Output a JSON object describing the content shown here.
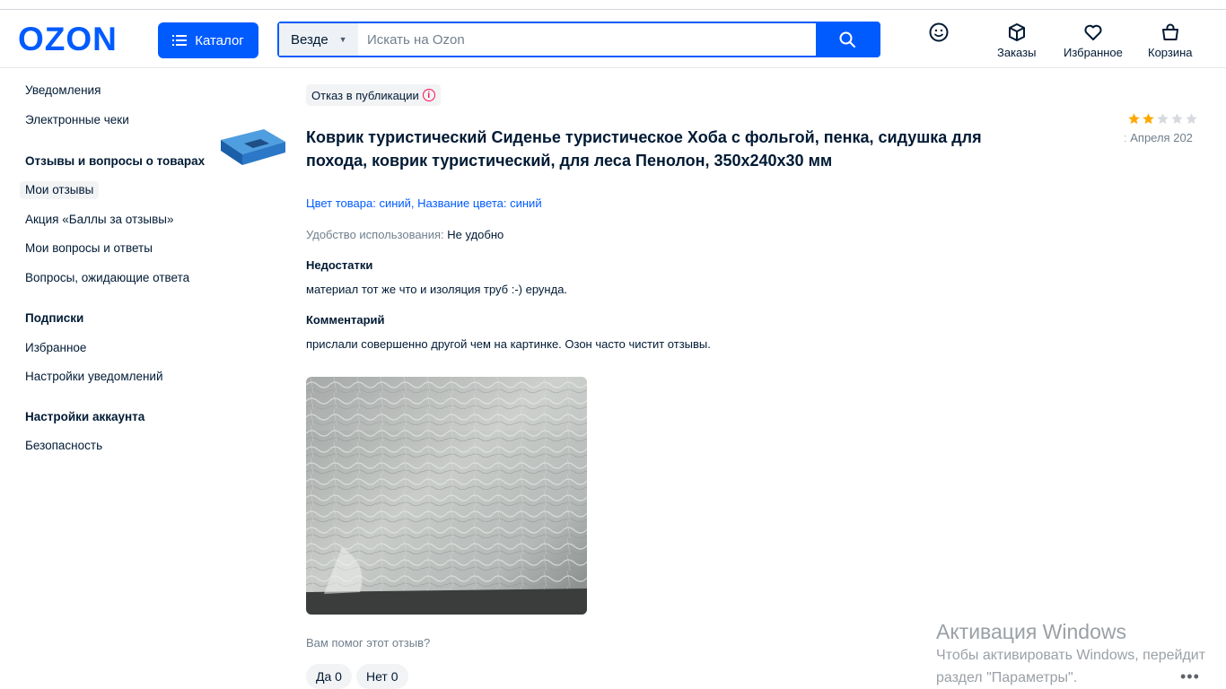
{
  "header": {
    "logo": "OZON",
    "catalog_label": "Каталог",
    "search_scope": "Везде",
    "search_placeholder": "Искать на Ozon",
    "icons": [
      {
        "name": "profile-icon",
        "label": ""
      },
      {
        "name": "orders-icon",
        "label": "Заказы"
      },
      {
        "name": "favorites-icon",
        "label": "Избранное"
      },
      {
        "name": "cart-icon",
        "label": "Корзина"
      }
    ]
  },
  "sidebar": {
    "items": [
      "Уведомления",
      "Электронные чеки",
      "Отзывы и вопросы о товарах",
      "Мои отзывы",
      "Акция «Баллы за отзывы»",
      "Мои вопросы и ответы",
      "Вопросы, ожидающие ответа",
      "Подписки",
      "Избранное",
      "Настройки уведомлений",
      "Настройки аккаунта",
      "Безопасность"
    ]
  },
  "review": {
    "status": "Отказ в публикации",
    "product_title": "Коврик туристический Сиденье туристическое Хоба с фольгой, пенка, сидушка для похода, коврик туристический, для леса Пенолон, 350x240x30 мм",
    "rating": 2,
    "rating_max": 5,
    "date": "Апреля 202",
    "variant": "Цвет товара: синий, Название цвета: синий",
    "usability_label": "Удобство использования:",
    "usability_value": "Не удобно",
    "cons_heading": "Недостатки",
    "cons_text": "материал тот же что и изоляция труб :-) ерунда.",
    "comment_heading": "Комментарий",
    "comment_text": "прислали совершенно другой чем на картинке. Озон часто чистит отзывы.",
    "helpful_question": "Вам помог этот отзыв?",
    "yes_label": "Да 0",
    "no_label": "Нет 0"
  },
  "watermark": {
    "title": "Активация Windows",
    "line1": "Чтобы активировать Windows, перейдит",
    "line2": "раздел \"Параметры\"."
  },
  "colors": {
    "brand": "#005bff",
    "star_filled": "#ffa800",
    "star_empty": "#d6d9de",
    "error": "#f91155"
  }
}
